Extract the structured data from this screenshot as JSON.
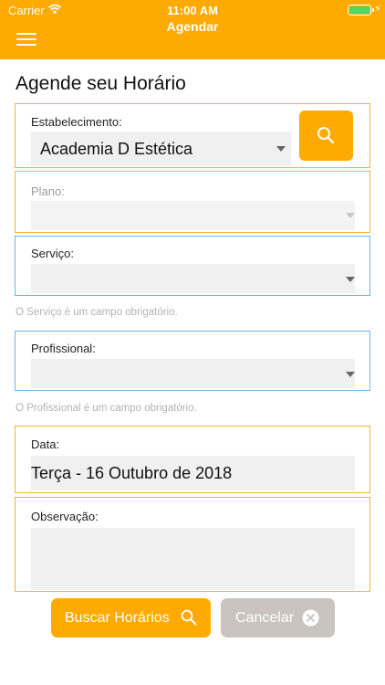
{
  "status_bar": {
    "carrier": "Carrier",
    "time": "11:00 AM"
  },
  "header": {
    "title": "Agendar",
    "menu_icon": "hamburger-menu-icon",
    "background": "#FFAA00"
  },
  "page_title": "Agende seu Horário",
  "form": {
    "estabelecimento": {
      "label": "Estabelecimento:",
      "value": "Academia D Estética"
    },
    "plano": {
      "label": "Plano:",
      "value": ""
    },
    "servico": {
      "label": "Serviço:",
      "value": "",
      "hint": "O Serviço é um campo obrigatório."
    },
    "profissional": {
      "label": "Profissional:",
      "value": "",
      "hint": "O Profissional é um campo obrigatório."
    },
    "data": {
      "label": "Data:",
      "value": "Terça - 16 Outubro de 2018"
    },
    "observacao": {
      "label": "Observação:",
      "value": ""
    }
  },
  "buttons": {
    "buscar": {
      "label": "Buscar Horários",
      "icon": "search-icon"
    },
    "cancelar": {
      "label": "Cancelar",
      "icon": "close-circle-icon"
    }
  },
  "colors": {
    "accent": "#FFAA00",
    "field_border": "#F5B233",
    "error_border": "#6BB8E0",
    "cancel": "#C9C4C0"
  }
}
